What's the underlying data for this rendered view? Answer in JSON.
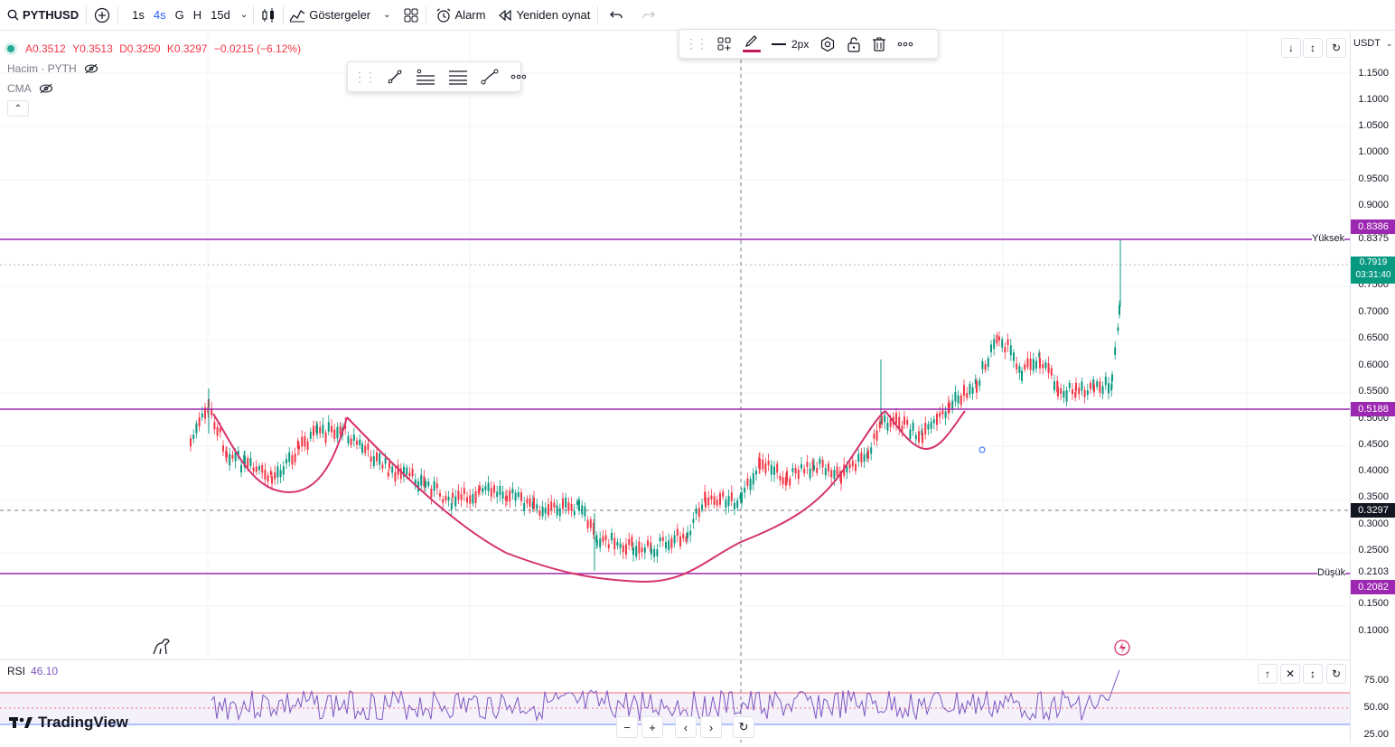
{
  "toolbar": {
    "symbol": "PYTHUSD",
    "intervals": [
      "1s",
      "4s",
      "G",
      "H",
      "15d"
    ],
    "active_interval": "4s",
    "indicators_label": "Göstergeler",
    "alert_label": "Alarm",
    "replay_label": "Yeniden oynat"
  },
  "legend": {
    "open": "A0.3512",
    "high": "Y0.3513",
    "low": "D0.3250",
    "close": "K0.3297",
    "change": "−0.0215 (−6.12%)",
    "volume_label": "Hacim · PYTH",
    "cma_label": "CMA"
  },
  "drawing_toolbar": {
    "width_label": "2px",
    "accent": "#c2185b"
  },
  "price_scale": {
    "currency": "USDT",
    "ticks": [
      "1.1500",
      "1.1000",
      "1.0500",
      "1.0000",
      "0.9500",
      "0.9000",
      "0.8375",
      "0.7500",
      "0.7000",
      "0.6500",
      "0.6000",
      "0.5500",
      "0.5000",
      "0.4500",
      "0.4000",
      "0.3500",
      "0.3000",
      "0.2500",
      "0.2103",
      "0.1500",
      "0.1000"
    ],
    "labels": {
      "high_line": "0.8386",
      "last_price": "0.7919",
      "countdown": "03:31:40",
      "mid_line": "0.5188",
      "crosshair": "0.3297",
      "low_line": "0.2082"
    }
  },
  "lines": {
    "high_text": "Yüksek",
    "low_text": "Düşük",
    "line_color": "#9c27b0",
    "curve_color": "#d6336c"
  },
  "rsi": {
    "label": "RSI",
    "value": "46.10",
    "ticks": [
      "75.00",
      "50.00",
      "25.00"
    ],
    "color": "#7e57c2"
  },
  "brand": {
    "name": "TradingView"
  },
  "colors": {
    "up": "#22ab94",
    "down": "#f23645",
    "accent": "#2962ff"
  }
}
